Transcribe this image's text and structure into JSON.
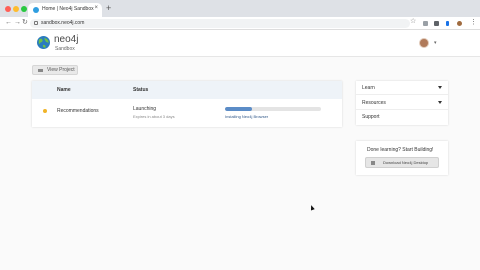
{
  "browser": {
    "tab_title": "Home | Neo4j Sandbox",
    "tab_close": "×",
    "new_tab": "+",
    "url": "sandbox.neo4j.com",
    "nav": {
      "back": "←",
      "forward": "→",
      "reload": "↻"
    },
    "star": "☆",
    "menu": "⋮",
    "traffic_colors": [
      "#ff5f57",
      "#febc2e",
      "#28c840"
    ]
  },
  "header": {
    "brand": "neo4j",
    "brand_sub": "Sandbox",
    "avatar_caret": "▾"
  },
  "toolbar": {
    "view_project_label": "View Project"
  },
  "projects_table": {
    "columns": [
      "Name",
      "Status"
    ],
    "rows": [
      {
        "status_color": "#f0b429",
        "name": "Recommendations",
        "status": "Launching",
        "expires": "Expires in about 3 days",
        "progress": 0.28,
        "progress_label": "Installing Neo4j Browser"
      }
    ]
  },
  "sidebar": {
    "items": [
      {
        "label": "Learn",
        "has_caret": true
      },
      {
        "label": "Resources",
        "has_caret": true
      },
      {
        "label": "Support",
        "has_caret": false
      }
    ]
  },
  "learn_card": {
    "title": "Done learning? Start Building!",
    "download_label": "Download Neo4j Desktop"
  },
  "colors": {
    "accent": "#5b8cc7",
    "header_bg": "#eef3f8",
    "status_launching": "#f0b429"
  }
}
